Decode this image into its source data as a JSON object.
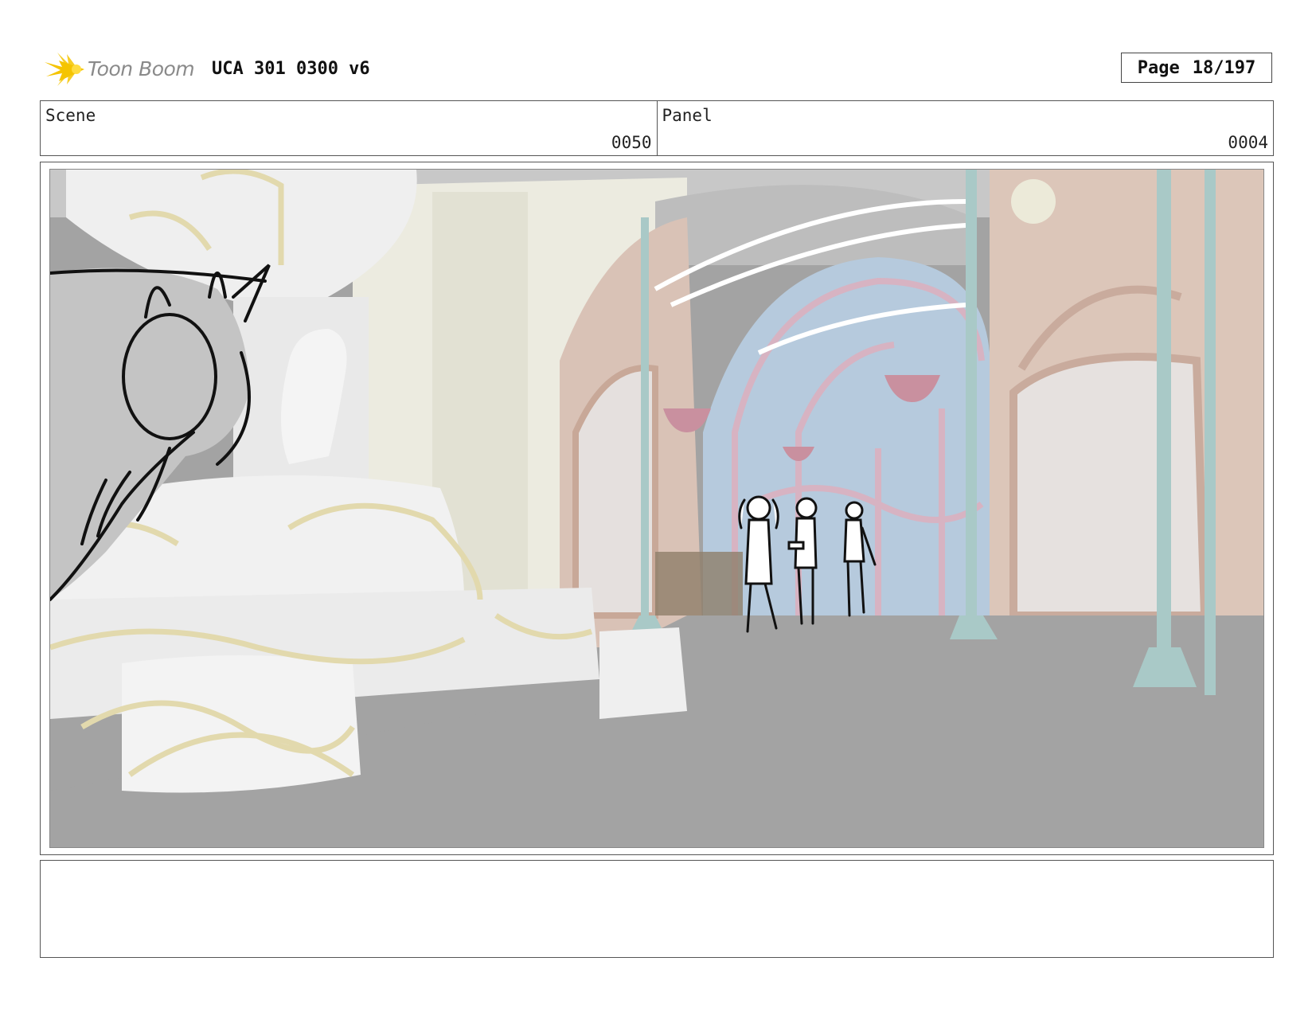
{
  "header": {
    "logo_text": "Toon Boom",
    "project_title": "UCA 301 0300 v6",
    "page_label": "Page",
    "page_number": "18/197"
  },
  "info": {
    "scene_label": "Scene",
    "scene_value": "0050",
    "panel_label": "Panel",
    "panel_value": "0004"
  },
  "notes": {
    "text": ""
  },
  "colors": {
    "frame_border": "#555555",
    "logo_accent": "#f5c400",
    "logo_text": "#8a8a8a"
  }
}
